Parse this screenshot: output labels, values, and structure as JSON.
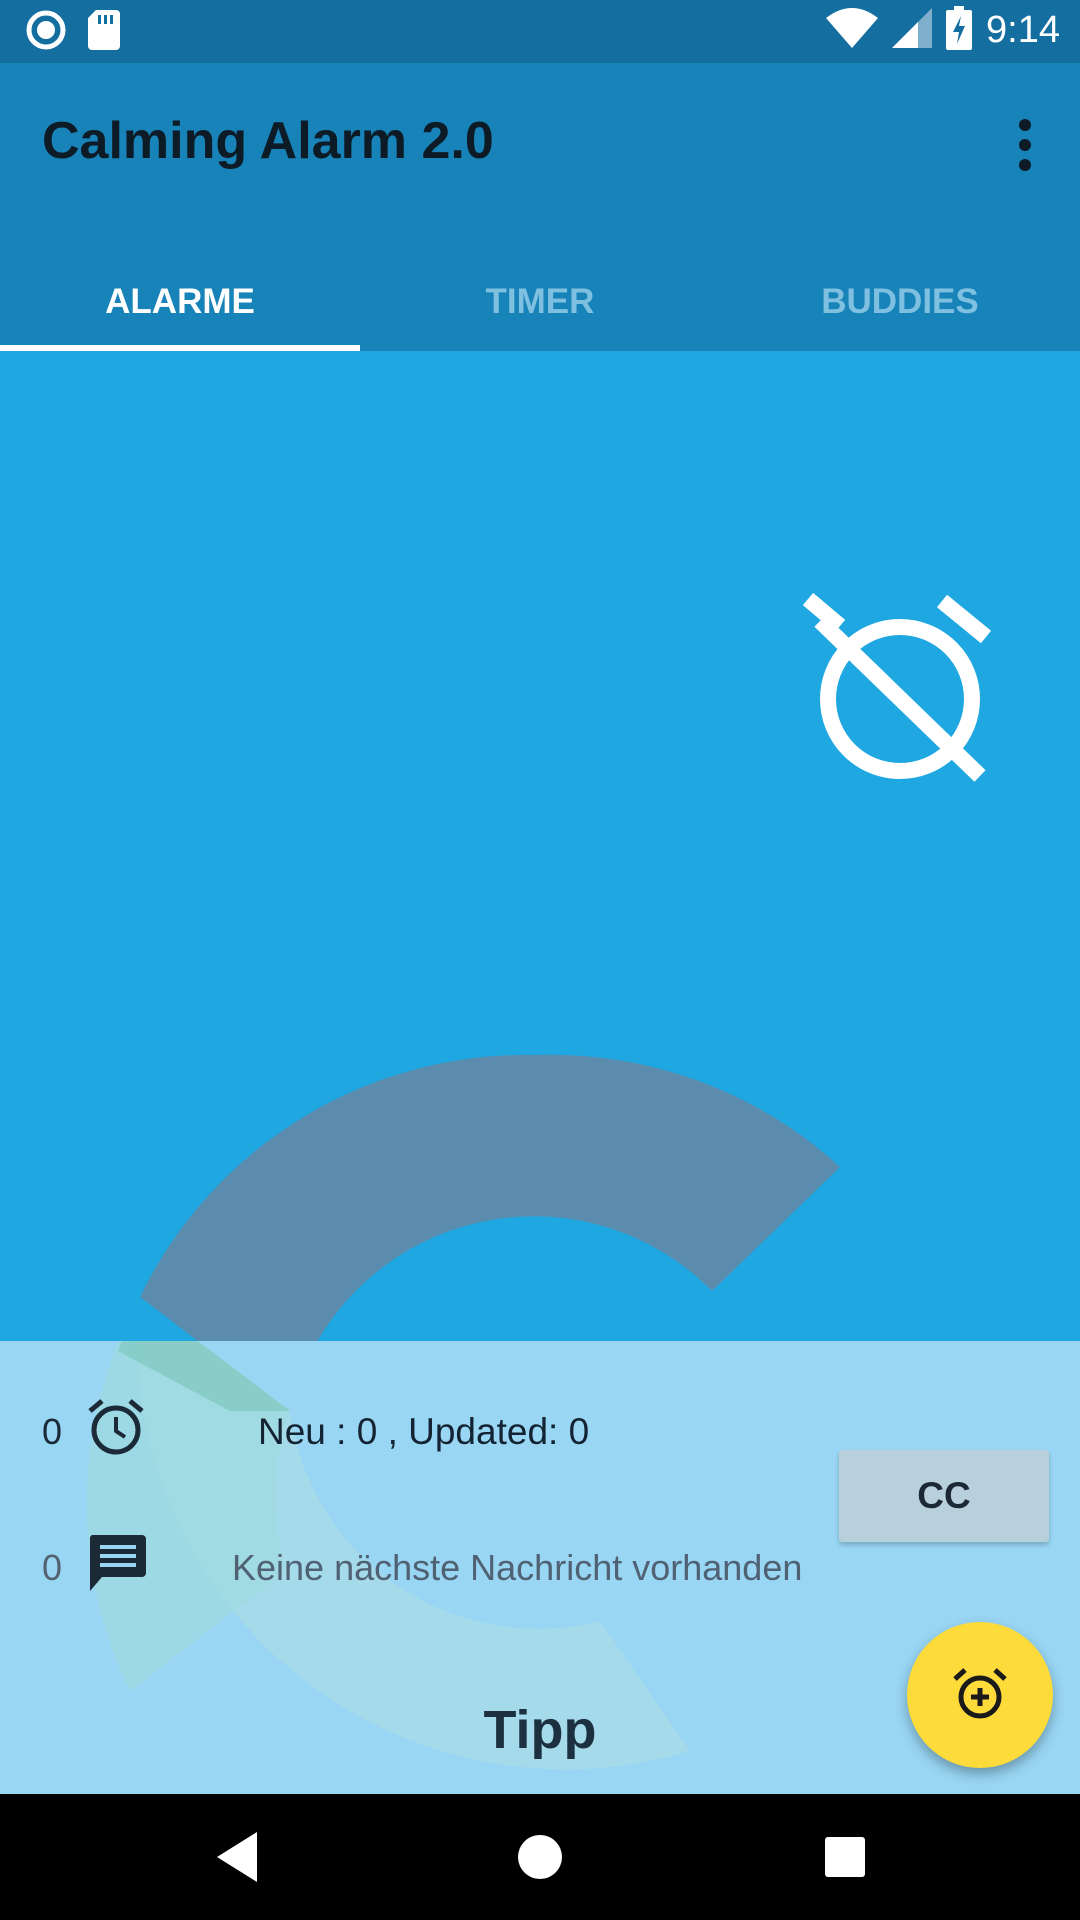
{
  "status_bar": {
    "time": "9:14",
    "icons": [
      "record-icon",
      "sd-card-icon",
      "wifi-icon",
      "cell-signal-icon",
      "battery-charging-icon"
    ]
  },
  "app_bar": {
    "title": "Calming Alarm 2.0",
    "menu_icon": "more-vert-icon"
  },
  "tabs": [
    {
      "label": "ALARME",
      "active": true
    },
    {
      "label": "TIMER",
      "active": false
    },
    {
      "label": "BUDDIES",
      "active": false
    }
  ],
  "main": {
    "status_icon": "alarm-off-icon"
  },
  "panel": {
    "alarm_count": "0",
    "sync_status": "Neu : 0 , Updated: 0",
    "message_count": "0",
    "next_message": "Keine nächste Nachricht vorhanden",
    "cc_label": "CC",
    "tip_title": "Tipp"
  },
  "fab": {
    "icon": "alarm-add-icon"
  },
  "nav_bar": {
    "buttons": [
      "back-icon",
      "home-icon",
      "recents-icon"
    ]
  },
  "colors": {
    "status_bar": "#146ea0",
    "app_bar": "#1783b8",
    "content": "#1ea7e1",
    "panel": "#98d6f3",
    "fab": "#fddb3a"
  }
}
